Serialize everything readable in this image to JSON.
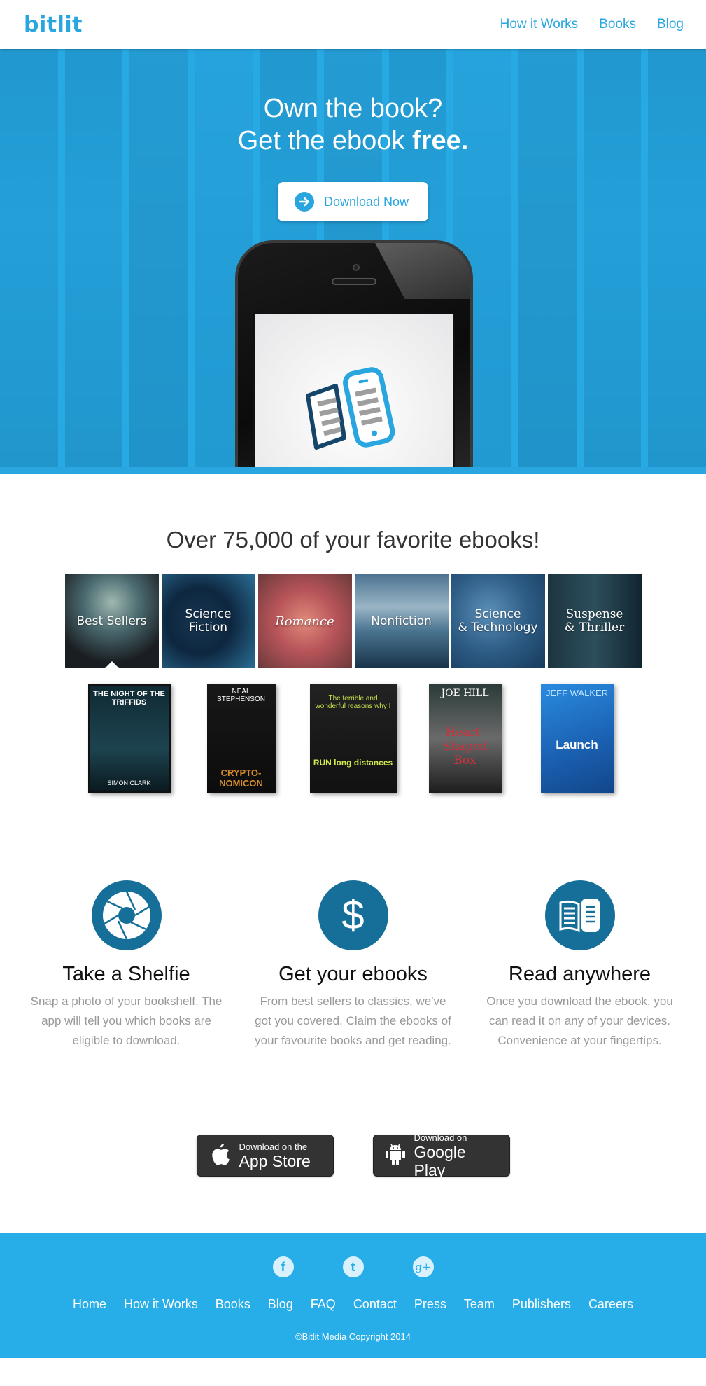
{
  "header": {
    "logo": "bitlit",
    "nav": [
      {
        "label": "How it Works"
      },
      {
        "label": "Books"
      },
      {
        "label": "Blog"
      }
    ]
  },
  "hero": {
    "title_line1": "Own the book?",
    "title_line2_prefix": "Get the ebook ",
    "title_line2_bold": "free.",
    "cta_label": "Download Now",
    "cta_icon": "arrow-right-circle-icon",
    "phone_screen_icon": "book-and-phone-icon"
  },
  "catalog": {
    "heading": "Over 75,000 of your favorite ebooks!",
    "categories": [
      {
        "label_line1": "Best Sellers",
        "label_line2": "",
        "selected": true
      },
      {
        "label_line1": "Science",
        "label_line2": "Fiction",
        "selected": false
      },
      {
        "label_line1": "Romance",
        "label_line2": "",
        "selected": false
      },
      {
        "label_line1": "Nonfiction",
        "label_line2": "",
        "selected": false
      },
      {
        "label_line1": "Science",
        "label_line2": "& Technology",
        "selected": false
      },
      {
        "label_line1": "Suspense",
        "label_line2": "& Thriller",
        "selected": false
      }
    ],
    "books": [
      {
        "top": "THE NIGHT OF THE TRIFFIDS",
        "bottom": "SIMON CLARK"
      },
      {
        "top": "NEAL STEPHENSON",
        "bottom": "CRYPTO-NOMICON"
      },
      {
        "top": "The terrible and wonderful reasons why I",
        "bottom": "RUN long distances"
      },
      {
        "top": "JOE HILL",
        "bottom": "Heart-Shaped Box"
      },
      {
        "top": "JEFF WALKER",
        "bottom": "Launch"
      }
    ]
  },
  "features": [
    {
      "icon": "camera-aperture-icon",
      "title": "Take a Shelfie",
      "text": "Snap a photo of your bookshelf. The app will tell you which books are eligible to download."
    },
    {
      "icon": "dollar-icon",
      "title": "Get your ebooks",
      "text": "From best sellers to classics, we've got you covered. Claim the ebooks of your favourite books and get reading."
    },
    {
      "icon": "book-and-tablet-icon",
      "title": "Read anywhere",
      "text": "Once you download the ebook, you can read it on any of your devices. Convenience at your fingertips."
    }
  ],
  "stores": [
    {
      "icon": "apple-icon",
      "small": "Download on the",
      "big": "App Store"
    },
    {
      "icon": "android-icon",
      "small": "Download on",
      "big": "Google Play"
    }
  ],
  "footer": {
    "social": [
      {
        "icon": "facebook-icon",
        "glyph": "f"
      },
      {
        "icon": "twitter-icon",
        "glyph": "t"
      },
      {
        "icon": "google-plus-icon",
        "glyph": "g+"
      }
    ],
    "nav": [
      "Home",
      "How it Works",
      "Books",
      "Blog",
      "FAQ",
      "Contact",
      "Press",
      "Team",
      "Publishers",
      "Careers"
    ],
    "copyright": "©Bitlit Media Copyright 2014"
  },
  "colors": {
    "brand_blue": "#29a6df",
    "feature_icon_blue": "#166f98",
    "footer_blue": "#27ade8",
    "store_button": "#333333"
  }
}
